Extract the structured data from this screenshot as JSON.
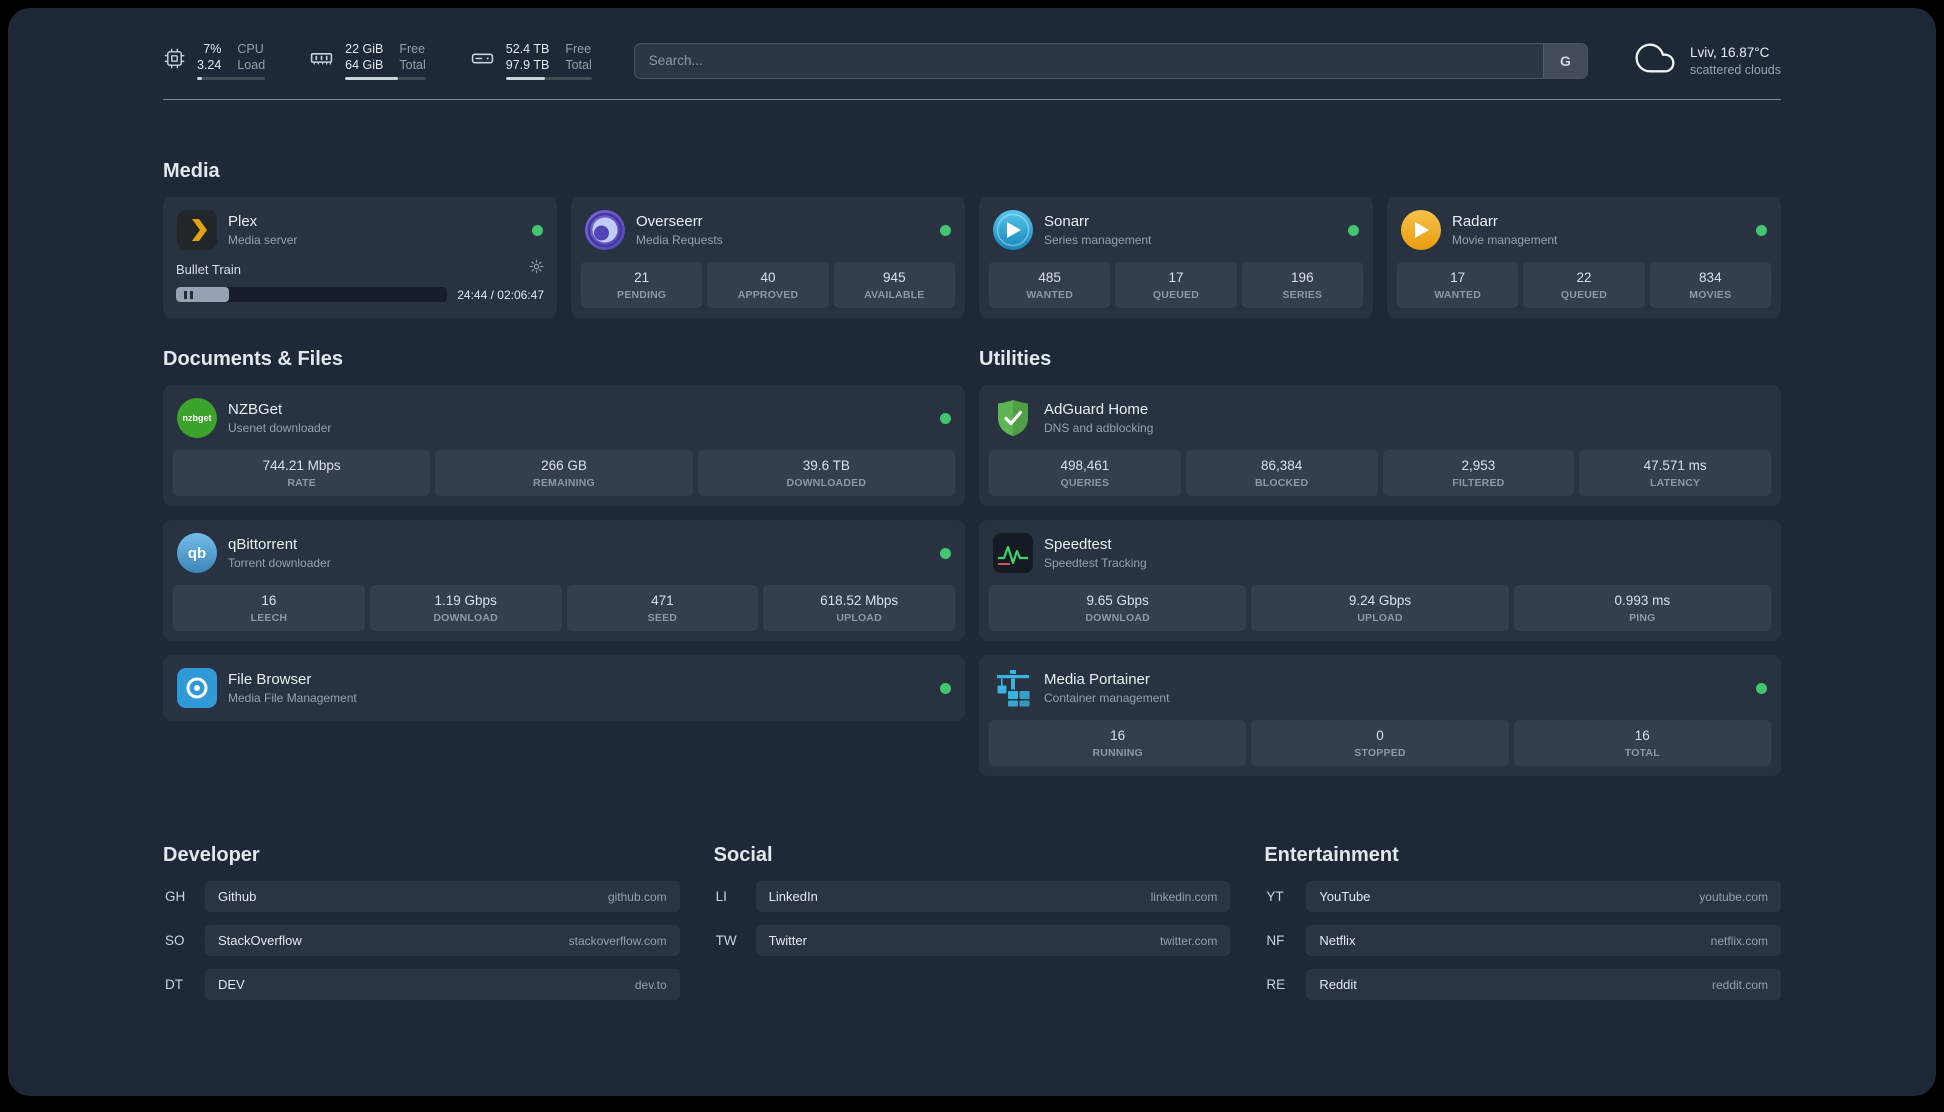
{
  "topbar": {
    "cpu": {
      "percent": "7%",
      "load": "3.24",
      "label_top": "CPU",
      "label_bottom": "Load",
      "bar_percent": 7
    },
    "memory": {
      "free": "22 GiB",
      "total": "64 GiB",
      "label_top": "Free",
      "label_bottom": "Total",
      "bar_percent": 66
    },
    "disk": {
      "free": "52.4 TB",
      "total": "97.9 TB",
      "label_top": "Free",
      "label_bottom": "Total",
      "bar_percent": 46
    },
    "search": {
      "placeholder": "Search...",
      "button": "G"
    },
    "weather": {
      "location": "Lviv, 16.87°C",
      "condition": "scattered clouds"
    }
  },
  "sections": {
    "media": "Media",
    "documents": "Documents & Files",
    "utilities": "Utilities",
    "developer": "Developer",
    "social": "Social",
    "entertainment": "Entertainment"
  },
  "services": {
    "plex": {
      "name": "Plex",
      "desc": "Media server",
      "now_playing": "Bullet Train",
      "time": "24:44 / 02:06:47",
      "progress_percent": 19.5,
      "status": "online"
    },
    "overseerr": {
      "name": "Overseerr",
      "desc": "Media Requests",
      "status": "online",
      "stats": [
        {
          "value": "21",
          "label": "PENDING"
        },
        {
          "value": "40",
          "label": "APPROVED"
        },
        {
          "value": "945",
          "label": "AVAILABLE"
        }
      ]
    },
    "sonarr": {
      "name": "Sonarr",
      "desc": "Series management",
      "status": "online",
      "stats": [
        {
          "value": "485",
          "label": "WANTED"
        },
        {
          "value": "17",
          "label": "QUEUED"
        },
        {
          "value": "196",
          "label": "SERIES"
        }
      ]
    },
    "radarr": {
      "name": "Radarr",
      "desc": "Movie management",
      "status": "online",
      "stats": [
        {
          "value": "17",
          "label": "WANTED"
        },
        {
          "value": "22",
          "label": "QUEUED"
        },
        {
          "value": "834",
          "label": "MOVIES"
        }
      ]
    },
    "nzbget": {
      "name": "NZBGet",
      "desc": "Usenet downloader",
      "status": "online",
      "stats": [
        {
          "value": "744.21 Mbps",
          "label": "RATE"
        },
        {
          "value": "266 GB",
          "label": "REMAINING"
        },
        {
          "value": "39.6 TB",
          "label": "DOWNLOADED"
        }
      ]
    },
    "qbittorrent": {
      "name": "qBittorrent",
      "desc": "Torrent downloader",
      "status": "online",
      "stats": [
        {
          "value": "16",
          "label": "LEECH"
        },
        {
          "value": "1.19 Gbps",
          "label": "DOWNLOAD"
        },
        {
          "value": "471",
          "label": "SEED"
        },
        {
          "value": "618.52 Mbps",
          "label": "UPLOAD"
        }
      ]
    },
    "filebrowser": {
      "name": "File Browser",
      "desc": "Media File Management",
      "status": "online"
    },
    "adguard": {
      "name": "AdGuard Home",
      "desc": "DNS and adblocking",
      "status": "online",
      "stats": [
        {
          "value": "498,461",
          "label": "QUERIES"
        },
        {
          "value": "86,384",
          "label": "BLOCKED"
        },
        {
          "value": "2,953",
          "label": "FILTERED"
        },
        {
          "value": "47.571 ms",
          "label": "LATENCY"
        }
      ]
    },
    "speedtest": {
      "name": "Speedtest",
      "desc": "Speedtest Tracking",
      "status": "online",
      "stats": [
        {
          "value": "9.65 Gbps",
          "label": "DOWNLOAD"
        },
        {
          "value": "9.24 Gbps",
          "label": "UPLOAD"
        },
        {
          "value": "0.993 ms",
          "label": "PING"
        }
      ]
    },
    "portainer": {
      "name": "Media Portainer",
      "desc": "Container management",
      "status": "online",
      "stats": [
        {
          "value": "16",
          "label": "RUNNING"
        },
        {
          "value": "0",
          "label": "STOPPED"
        },
        {
          "value": "16",
          "label": "TOTAL"
        }
      ]
    }
  },
  "bookmarks": {
    "developer": [
      {
        "abbr": "GH",
        "name": "Github",
        "url": "github.com"
      },
      {
        "abbr": "SO",
        "name": "StackOverflow",
        "url": "stackoverflow.com"
      },
      {
        "abbr": "DT",
        "name": "DEV",
        "url": "dev.to"
      }
    ],
    "social": [
      {
        "abbr": "LI",
        "name": "LinkedIn",
        "url": "linkedin.com"
      },
      {
        "abbr": "TW",
        "name": "Twitter",
        "url": "twitter.com"
      }
    ],
    "entertainment": [
      {
        "abbr": "YT",
        "name": "YouTube",
        "url": "youtube.com"
      },
      {
        "abbr": "NF",
        "name": "Netflix",
        "url": "netflix.com"
      },
      {
        "abbr": "RE",
        "name": "Reddit",
        "url": "reddit.com"
      }
    ]
  },
  "colors": {
    "status_online": "#41c56f",
    "plex_gold": "#e5a00d",
    "accent_green": "#3fd06b"
  }
}
